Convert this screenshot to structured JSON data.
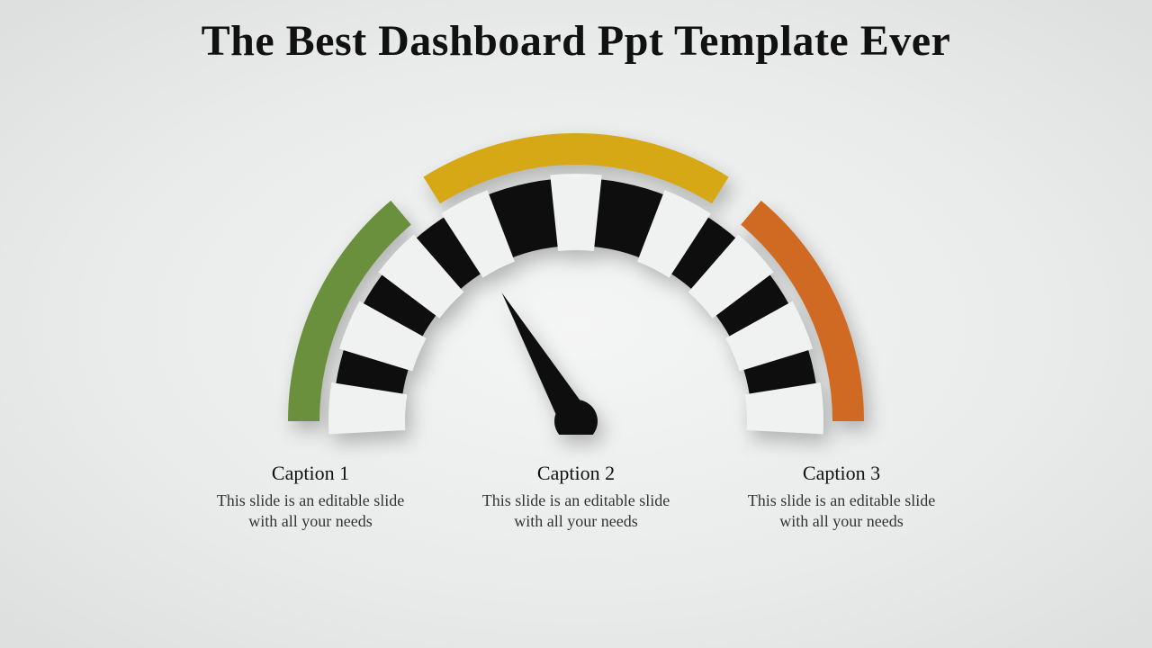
{
  "title": "The Best Dashboard Ppt Template Ever",
  "gauge": {
    "segments": [
      {
        "color": "#6a8f3d",
        "start_deg": 180,
        "end_deg": 130
      },
      {
        "color": "#d6a815",
        "start_deg": 122,
        "end_deg": 58
      },
      {
        "color": "#d06a23",
        "start_deg": 50,
        "end_deg": 0
      }
    ],
    "needle_angle_deg": 120,
    "tick_count": 9,
    "tick_angles_deg": [
      177,
      157,
      137,
      117,
      90,
      63,
      43,
      23,
      3
    ]
  },
  "captions": [
    {
      "title": "Caption 1",
      "body": "This slide is an editable slide with all your needs"
    },
    {
      "title": "Caption 2",
      "body": "This slide is an editable slide with all your needs"
    },
    {
      "title": "Caption 3",
      "body": "This slide is an editable slide with all your needs"
    }
  ]
}
